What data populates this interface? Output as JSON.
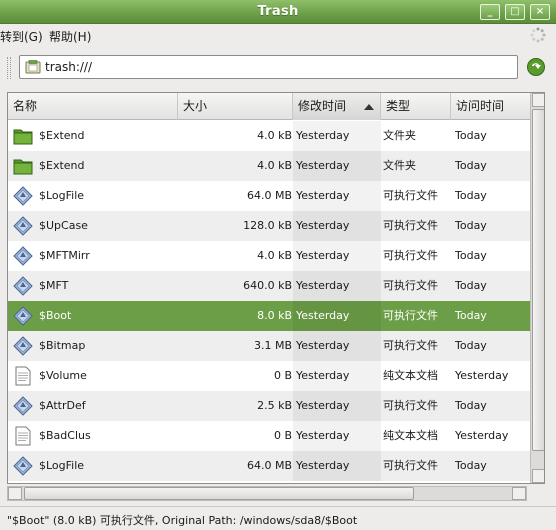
{
  "window": {
    "title": "Trash",
    "buttons": {
      "minimize": "_",
      "maximize": "□",
      "close": "×"
    }
  },
  "menu": {
    "items": [
      {
        "label": "跳转到(G)"
      },
      {
        "label": "帮助(H)"
      }
    ]
  },
  "location": {
    "value": "trash:///",
    "icon": "trash-folder-icon",
    "go_icon": "go-arrow-icon"
  },
  "columns": {
    "name": "名称",
    "size": "大小",
    "modified": "修改时间",
    "type": "类型",
    "accessed": "访问时间",
    "sorted_by": "modified"
  },
  "files": [
    {
      "icon": "folder-icon",
      "name": "$Extend",
      "size": "4.0 kB",
      "modified": "Yesterday",
      "type": "文件夹",
      "accessed": "Today"
    },
    {
      "icon": "folder-icon",
      "name": "$Extend",
      "size": "4.0 kB",
      "modified": "Yesterday",
      "type": "文件夹",
      "accessed": "Today"
    },
    {
      "icon": "executable-icon",
      "name": "$LogFile",
      "size": "64.0 MB",
      "modified": "Yesterday",
      "type": "可执行文件",
      "accessed": "Today"
    },
    {
      "icon": "executable-icon",
      "name": "$UpCase",
      "size": "128.0 kB",
      "modified": "Yesterday",
      "type": "可执行文件",
      "accessed": "Today"
    },
    {
      "icon": "executable-icon",
      "name": "$MFTMirr",
      "size": "4.0 kB",
      "modified": "Yesterday",
      "type": "可执行文件",
      "accessed": "Today"
    },
    {
      "icon": "executable-icon",
      "name": "$MFT",
      "size": "640.0 kB",
      "modified": "Yesterday",
      "type": "可执行文件",
      "accessed": "Today"
    },
    {
      "icon": "executable-icon",
      "name": "$Boot",
      "size": "8.0 kB",
      "modified": "Yesterday",
      "type": "可执行文件",
      "accessed": "Today",
      "selected": true
    },
    {
      "icon": "executable-icon",
      "name": "$Bitmap",
      "size": "3.1 MB",
      "modified": "Yesterday",
      "type": "可执行文件",
      "accessed": "Today"
    },
    {
      "icon": "text-file-icon",
      "name": "$Volume",
      "size": "0 B",
      "modified": "Yesterday",
      "type": "纯文本文档",
      "accessed": "Yesterday"
    },
    {
      "icon": "executable-icon",
      "name": "$AttrDef",
      "size": "2.5 kB",
      "modified": "Yesterday",
      "type": "可执行文件",
      "accessed": "Today"
    },
    {
      "icon": "text-file-icon",
      "name": "$BadClus",
      "size": "0 B",
      "modified": "Yesterday",
      "type": "纯文本文档",
      "accessed": "Yesterday"
    },
    {
      "icon": "executable-icon",
      "name": "$LogFile",
      "size": "64.0 MB",
      "modified": "Yesterday",
      "type": "可执行文件",
      "accessed": "Today"
    }
  ],
  "status": "\"$Boot\" (8.0 kB) 可执行文件, Original Path: /windows/sda8/$Boot",
  "colors": {
    "accent": "#6c9e48",
    "titlebar": "#6fa04a"
  }
}
